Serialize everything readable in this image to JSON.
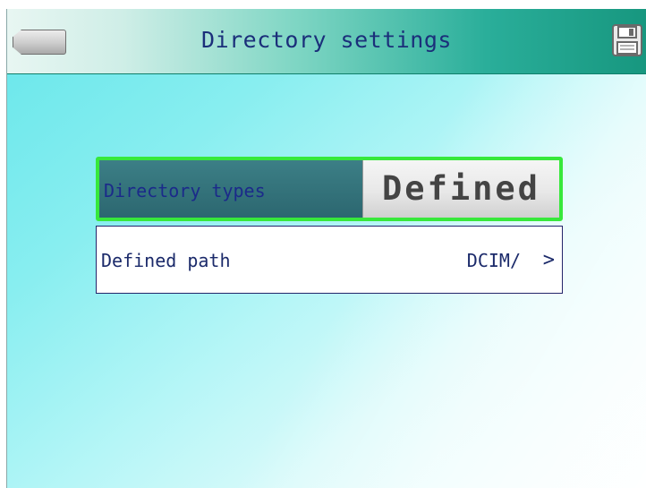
{
  "header": {
    "title": "Directory settings",
    "back_icon": "back-arrow-icon",
    "save_icon": "floppy-disk-icon"
  },
  "settings": {
    "directory_types": {
      "label": "Directory types",
      "value": "Defined"
    },
    "defined_path": {
      "label": "Defined path",
      "value": "DCIM/",
      "chevron": ">"
    }
  },
  "colors": {
    "header_gradient_end": "#17977f",
    "selected_border": "#37e83b",
    "text_blue": "#1b2a8a",
    "background": "#88eef0"
  }
}
